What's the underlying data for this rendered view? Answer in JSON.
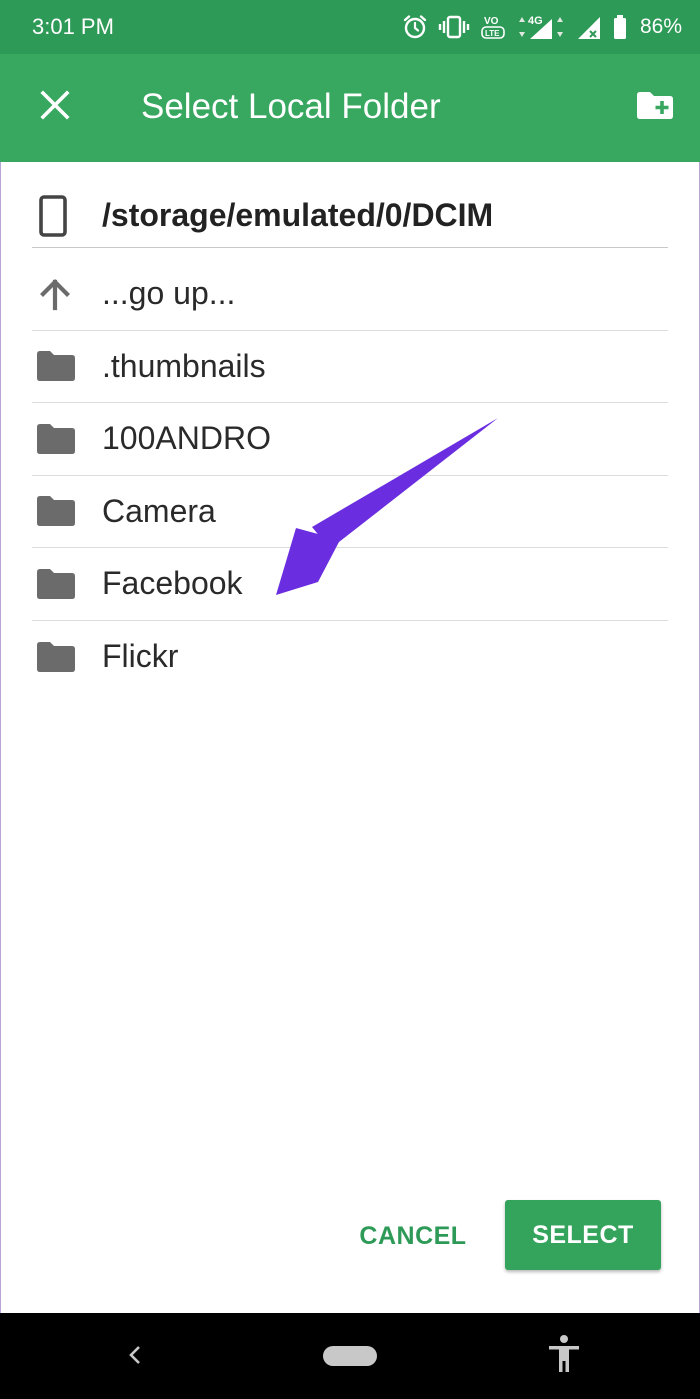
{
  "status_bar": {
    "time": "3:01 PM",
    "battery_percent": "86%",
    "icons": [
      "alarm-icon",
      "vibrate-icon",
      "volte-icon",
      "4g-signal-icon",
      "signal-icon",
      "battery-icon"
    ]
  },
  "app_bar": {
    "title": "Select Local Folder",
    "close_icon": "close-icon",
    "action_icon": "create-folder-icon"
  },
  "path": {
    "text": "/storage/emulated/0/DCIM",
    "icon": "phone-icon"
  },
  "folders": [
    {
      "label": "...go up...",
      "icon": "arrow-up-icon"
    },
    {
      "label": ".thumbnails",
      "icon": "folder-icon"
    },
    {
      "label": "100ANDRO",
      "icon": "folder-icon"
    },
    {
      "label": "Camera",
      "icon": "folder-icon"
    },
    {
      "label": "Facebook",
      "icon": "folder-icon"
    },
    {
      "label": "Flickr",
      "icon": "folder-icon"
    }
  ],
  "annotation": {
    "color": "#6a2ee0",
    "points_to": "Facebook"
  },
  "actions": {
    "cancel": "CANCEL",
    "select": "SELECT"
  },
  "colors": {
    "status_bar": "#2e9a57",
    "app_bar": "#38a860",
    "accent": "#34a35c",
    "icon_grey": "#6b6b6b"
  },
  "nav_bar": {
    "icons": [
      "back-icon",
      "home-pill",
      "accessibility-icon"
    ]
  }
}
